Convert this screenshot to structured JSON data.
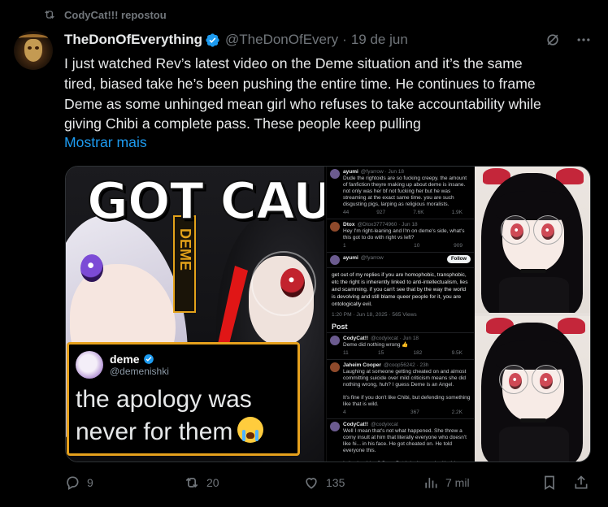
{
  "repost": {
    "text": "CodyCat!!! repostou",
    "icon": "repost-icon"
  },
  "tweet": {
    "author_name": "TheDonOfEverything",
    "handle": "@TheDonOfEvery",
    "separator": "·",
    "date": "19 de jun",
    "verified": true,
    "text": "I just watched Rev’s latest video on the Deme situation and it’s the same\ntired, biased take he’s been pushing the entire time. He continues to frame\nDeme as some unhinged mean girl who refuses to take accountability while\ngiving Chibi a complete pass. These people keep pulling",
    "show_more": "Mostrar mais"
  },
  "media": {
    "left_panel": {
      "headline": "GOT CAUG",
      "banner_text": "DEME",
      "quote": {
        "name": "deme",
        "handle": "@demenishki",
        "text": "the apology was never for them"
      }
    },
    "middle_panel": {
      "tweets": [
        {
          "name": "ayumi",
          "meta": "@fyarrow · Jun 18",
          "text": "Dude the rightoids are so fucking creepy. the amount of fanfiction theyre making up about deme is insane. not only was her bf not fucking her but he was streaming at the exact same time. you are such disgusting pigs, larping as religious moralists.",
          "actions": [
            "44",
            "927",
            "7.6K",
            "1.9K"
          ]
        },
        {
          "name": "Dtox",
          "meta": "@Dtox37774960 · Jun 18",
          "text": "Hey I'm right-leaning and I'm on deme's side, what's this got to do with right vs left?",
          "actions": [
            "1",
            "",
            "10",
            "909"
          ]
        },
        {
          "name": "ayumi",
          "meta": "@fyarrow",
          "follow": "Follow",
          "text": ""
        }
      ],
      "big_reply": "get out of my replies if you are homophobic, transphobic, etc the right is inherently linked to anti-intellectualism, lies and scamming. if you can't see that by the way the world is devolving and still blame queer people for it, you are ontologically evil.",
      "big_reply_ts": "1:20 PM · Jun 18, 2025 · 565 Views",
      "post_label": "Post",
      "tweets2": [
        {
          "name": "CodyCat!!",
          "meta": "@codyixcat · Jun 18",
          "text": "Deme did nothing wrong 👍",
          "actions": [
            "11",
            "15",
            "182",
            "9.5K"
          ]
        },
        {
          "name": "Jaheim Cooper",
          "meta": "@coop56242 · 23h",
          "text": "Laughing at someone getting cheated on and almost committing suicide over mild criticism means she did nothing wrong, huh? I guess Deme is an Angel.\n\nIt's fine if you don't like Chibi, but defending something like that is wild.",
          "actions": [
            "4",
            "",
            "367",
            "2.2K"
          ]
        },
        {
          "name": "CodyCat!!",
          "meta": "@codyixcat",
          "text": "Well I mean that's not what happened. She threw a corny insult at him that literally everyone who doesn't like hi... in his face. He got cheated on. He told everyone this.\n\nIs it a low blow? Sure. But I don't see why it's this worth overreacting about",
          "actions": []
        }
      ]
    }
  },
  "actions": {
    "reply": {
      "icon": "reply-icon",
      "count": "9"
    },
    "repost": {
      "icon": "repost-icon",
      "count": "20"
    },
    "like": {
      "icon": "heart-icon",
      "count": "135"
    },
    "views": {
      "icon": "views-icon",
      "count": "7 mil"
    },
    "bookmark": {
      "icon": "bookmark-icon"
    },
    "share": {
      "icon": "share-icon"
    }
  },
  "colors": {
    "accent": "#1d9bf0",
    "muted": "#71767b",
    "text": "#e7e9ea",
    "background": "#000000"
  }
}
